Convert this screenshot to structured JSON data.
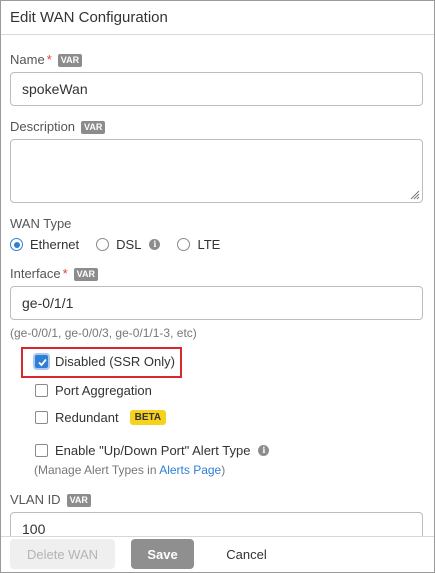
{
  "dialog": {
    "title": "Edit WAN Configuration"
  },
  "badges": {
    "var": "VAR",
    "required": "*",
    "beta": "BETA"
  },
  "name": {
    "label": "Name",
    "value": "spokeWan"
  },
  "description": {
    "label": "Description",
    "value": ""
  },
  "wan_type": {
    "label": "WAN Type",
    "options": [
      {
        "label": "Ethernet",
        "selected": true
      },
      {
        "label": "DSL",
        "selected": false
      },
      {
        "label": "LTE",
        "selected": false
      }
    ]
  },
  "interface": {
    "label": "Interface",
    "value": "ge-0/1/1",
    "hint": "(ge-0/0/1, ge-0/0/3, ge-0/1/1-3, etc)"
  },
  "checkboxes": {
    "disabled": {
      "label": "Disabled (SSR Only)",
      "checked": true
    },
    "port_aggregation": {
      "label": "Port Aggregation",
      "checked": false
    },
    "redundant": {
      "label": "Redundant",
      "checked": false
    },
    "alert": {
      "label": "Enable \"Up/Down Port\" Alert Type",
      "checked": false
    }
  },
  "alert_hint": {
    "prefix": "(Manage Alert Types in ",
    "link": "Alerts Page",
    "suffix": ")"
  },
  "vlan": {
    "label": "VLAN ID",
    "value": "100"
  },
  "footer": {
    "delete_label": "Delete WAN",
    "save_label": "Save",
    "cancel_label": "Cancel"
  },
  "colors": {
    "accent": "#2e7fd6",
    "highlight": "#d6282d",
    "beta": "#f6d21c",
    "required": "#e0403a"
  }
}
